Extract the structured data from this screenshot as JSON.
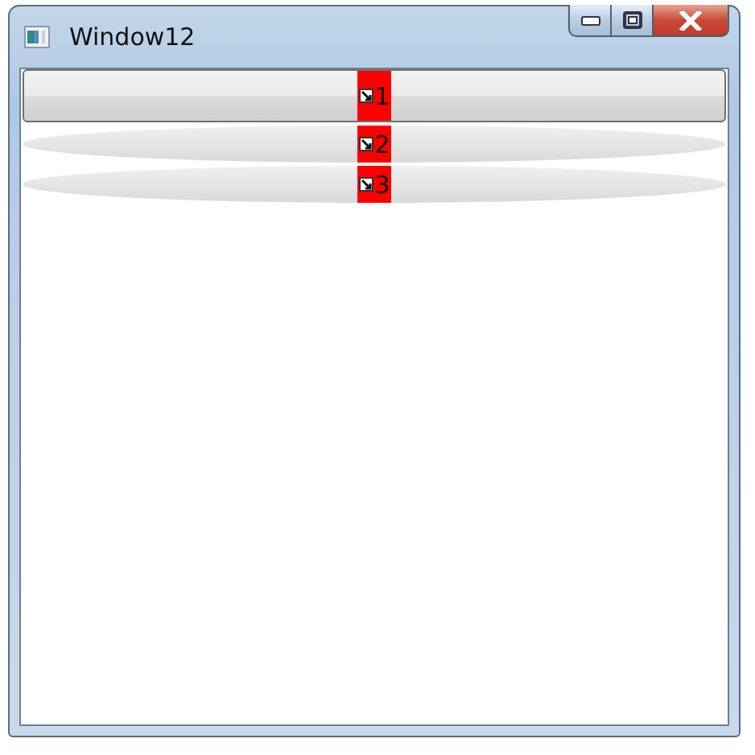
{
  "window": {
    "title": "Window12"
  },
  "items": [
    {
      "label": "1",
      "selected": true
    },
    {
      "label": "2",
      "selected": false
    },
    {
      "label": "3",
      "selected": false
    }
  ]
}
